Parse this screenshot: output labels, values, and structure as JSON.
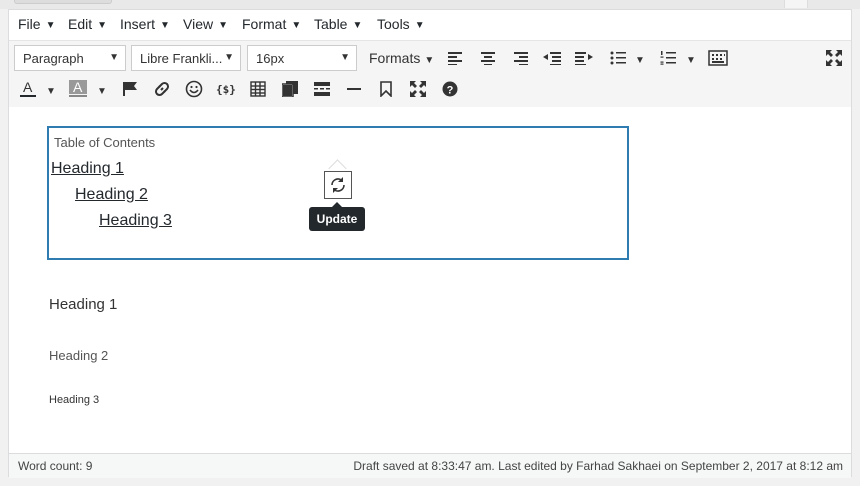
{
  "menubar": {
    "items": [
      {
        "label": "File"
      },
      {
        "label": "Edit"
      },
      {
        "label": "Insert"
      },
      {
        "label": "View"
      },
      {
        "label": "Format"
      },
      {
        "label": "Table"
      },
      {
        "label": "Tools"
      }
    ]
  },
  "toolbar": {
    "block_format": "Paragraph",
    "font_family": "Libre Frankli...",
    "font_size": "16px",
    "formats_label": "Formats",
    "icons": [
      "align-left-icon",
      "align-center-icon",
      "align-right-icon",
      "outdent-icon",
      "indent-icon",
      "bullet-list-icon",
      "numbered-list-icon",
      "toolbar-toggle-icon",
      "fullscreen-icon",
      "text-color-icon",
      "background-color-icon",
      "flag-icon",
      "link-icon",
      "emoticon-icon",
      "code-icon",
      "table-icon",
      "paste-icon",
      "page-break-icon",
      "horizontal-rule-icon",
      "bookmark-icon",
      "distraction-free-icon",
      "help-icon"
    ],
    "accent_color": "#2e7cb0"
  },
  "toc": {
    "title": "Table of Contents",
    "links": [
      {
        "label": "Heading 1"
      },
      {
        "label": "Heading 2"
      },
      {
        "label": "Heading 3"
      }
    ],
    "update_tooltip": "Update"
  },
  "content": {
    "heading1": "Heading 1",
    "heading2": "Heading 2",
    "heading3": "Heading 3"
  },
  "status": {
    "word_count": "Word count: 9",
    "saved": "Draft saved at 8:33:47 am. Last edited by Farhad Sakhaei on September 2, 2017 at 8:12 am"
  }
}
